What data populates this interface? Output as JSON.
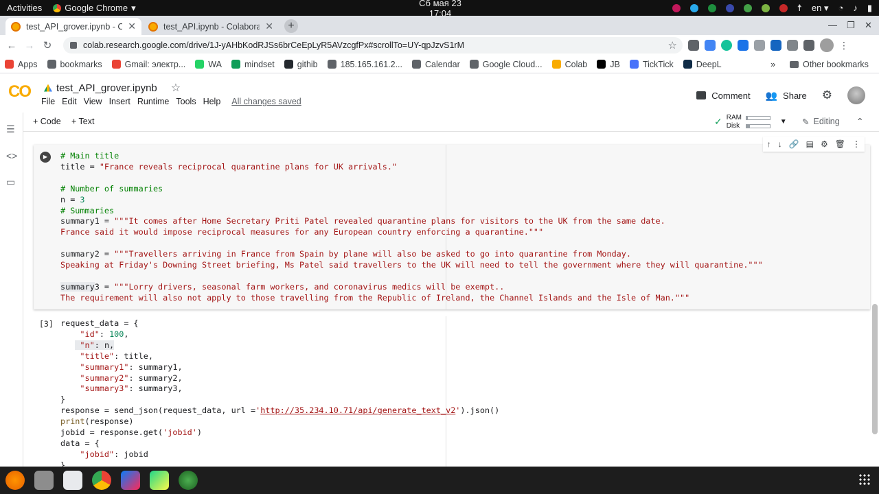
{
  "gnome": {
    "activities": "Activities",
    "app_menu": "Google Chrome",
    "clock": "Сб мая 23  17:04",
    "lang": "en"
  },
  "tabs": [
    {
      "label": "test_API_grover.ipynb - Co",
      "active": true
    },
    {
      "label": "test_API.ipynb - Colabora",
      "active": false
    }
  ],
  "address": {
    "url": "colab.research.google.com/drive/1J-yAHbKodRJSs6brCeEpLyR5AVzcgfPx#scrollTo=UY-qpJzvS1rM"
  },
  "bookmarks": [
    {
      "label": "Apps",
      "icon": "apps-icon",
      "color": "#ea4335"
    },
    {
      "label": "bookmarks",
      "icon": "star-icon",
      "color": "#5f6368"
    },
    {
      "label": "Gmail: электр...",
      "icon": "gmail-icon",
      "color": "#ea4335"
    },
    {
      "label": "WA",
      "icon": "whatsapp-icon",
      "color": "#25d366"
    },
    {
      "label": "mindset",
      "icon": "plus-icon",
      "color": "#0f9d58"
    },
    {
      "label": "githib",
      "icon": "github-icon",
      "color": "#24292e"
    },
    {
      "label": "185.165.161.2...",
      "icon": "globe-icon",
      "color": "#5f6368"
    },
    {
      "label": "Calendar",
      "icon": "globe-icon",
      "color": "#5f6368"
    },
    {
      "label": "Google Cloud...",
      "icon": "cloud-icon",
      "color": "#5f6368"
    },
    {
      "label": "Colab",
      "icon": "colab-icon",
      "color": "#f9ab00"
    },
    {
      "label": "JB",
      "icon": "jetbrains-icon",
      "color": "#000000"
    },
    {
      "label": "TickTick",
      "icon": "ticktick-icon",
      "color": "#4772fa"
    },
    {
      "label": "DeepL",
      "icon": "deepl-icon",
      "color": "#0f2b46"
    }
  ],
  "bookmarks_more": "»",
  "other_bookmarks": "Other bookmarks",
  "colab": {
    "logo": "CO",
    "title": "test_API_grover.ipynb",
    "menu": [
      "File",
      "Edit",
      "View",
      "Insert",
      "Runtime",
      "Tools",
      "Help"
    ],
    "saved": "All changes saved",
    "comment": "Comment",
    "share": "Share",
    "code_btn": "+ Code",
    "text_btn": "+ Text",
    "ram_label": "RAM",
    "disk_label": "Disk",
    "ram_fraction": 0.08,
    "disk_fraction": 0.15,
    "editing": "Editing"
  },
  "cell2_count": "[3]",
  "colors": {
    "accent": "#f9ab00",
    "comment": "#008000",
    "string": "#a31515",
    "number": "#098658"
  }
}
